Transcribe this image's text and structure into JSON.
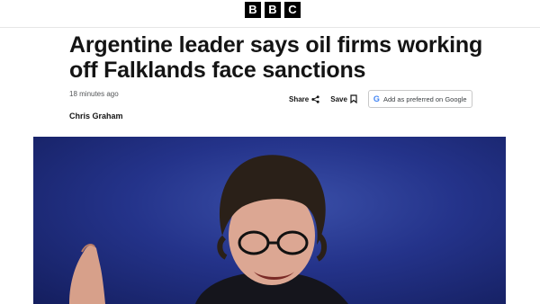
{
  "masthead": {
    "logo_letters": [
      "B",
      "B",
      "C"
    ]
  },
  "article": {
    "headline": "Argentine leader says oil firms working off Falklands face sanctions",
    "timestamp": "18 minutes ago",
    "author": "Chris Graham"
  },
  "actions": {
    "share_label": "Share",
    "save_label": "Save",
    "google_label": "Add as preferred on Google",
    "google_letter": "G"
  },
  "icons": {
    "share": "share-icon",
    "save": "bookmark-icon",
    "google": "google-logo-icon"
  },
  "colors": {
    "hero_background": "#24338a",
    "text": "#141414",
    "muted": "#545658"
  }
}
